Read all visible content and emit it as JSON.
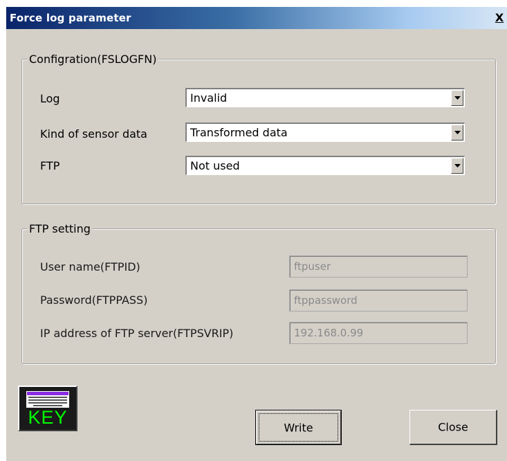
{
  "window": {
    "title": "Force log parameter",
    "close_label": "X"
  },
  "config_group": {
    "legend": "Configration(FSLOGFN)",
    "fields": [
      {
        "label": "Log",
        "value": "Invalid"
      },
      {
        "label": "Kind of sensor data",
        "value": "Transformed data"
      },
      {
        "label": "FTP",
        "value": "Not used"
      }
    ]
  },
  "ftp_group": {
    "legend": "FTP setting",
    "fields": [
      {
        "label": "User name(FTPID)",
        "value": "ftpuser"
      },
      {
        "label": "Password(FTPPASS)",
        "value": "ftppassword"
      },
      {
        "label": "IP address of FTP server(FTPSVRIP)",
        "value": "192.168.0.99"
      }
    ]
  },
  "keyboard_button": {
    "label": "KEY",
    "icon": "keyboard-icon"
  },
  "buttons": {
    "write": "Write",
    "close": "Close"
  },
  "colors": {
    "title_start": "#0a246a",
    "title_end": "#a6caf0",
    "dialog_bg": "#d4d0c8",
    "key_text": "#00ff00",
    "keyboard_accent": "#8a2be2"
  }
}
